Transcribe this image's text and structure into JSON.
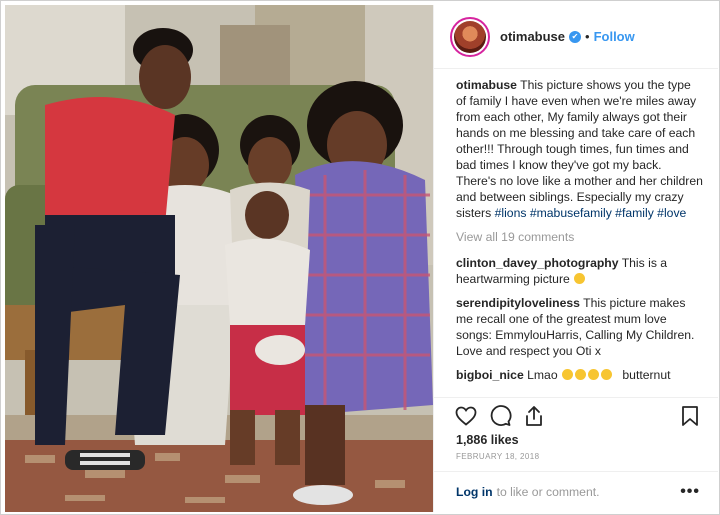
{
  "post": {
    "username": "otimabuse",
    "follow_label": "Follow",
    "separator": "•"
  },
  "caption": {
    "username": "otimabuse",
    "text": "This picture shows you the type of family I have even when we're miles away from each other, My family always got their hands on me blessing and take care of each other!!! Through tough times, fun times and bad times I know they've got my back. There's no love like a mother and her children and between siblings. Especially my crazy sisters ",
    "hashtags": "#lions #mabusefamily #family #love"
  },
  "view_all_comments": "View all 19 comments",
  "comments": [
    {
      "username": "clinton_davey_photography",
      "text": "This is a heartwarming picture"
    },
    {
      "username": "serendipityloveliness",
      "text": "This picture makes me recall one of the greatest mum love songs: EmmylouHarris, Calling My Children. Love and respect you Oti x"
    },
    {
      "username": "bigboi_nice",
      "text": "Lmao",
      "trail": "butternut"
    }
  ],
  "likes": "1,886 likes",
  "date": "FEBRUARY 18, 2018",
  "footer": {
    "login_label": "Log in",
    "rest": "to like or comment.",
    "more": "•••"
  },
  "icons": {
    "verified": "verified-badge-icon",
    "like": "heart-icon",
    "comment": "comment-bubble-icon",
    "share": "share-icon",
    "save": "bookmark-icon"
  },
  "colors": {
    "link": "#3897f0",
    "hashtag": "#003569",
    "muted": "#999999",
    "text": "#262626"
  }
}
